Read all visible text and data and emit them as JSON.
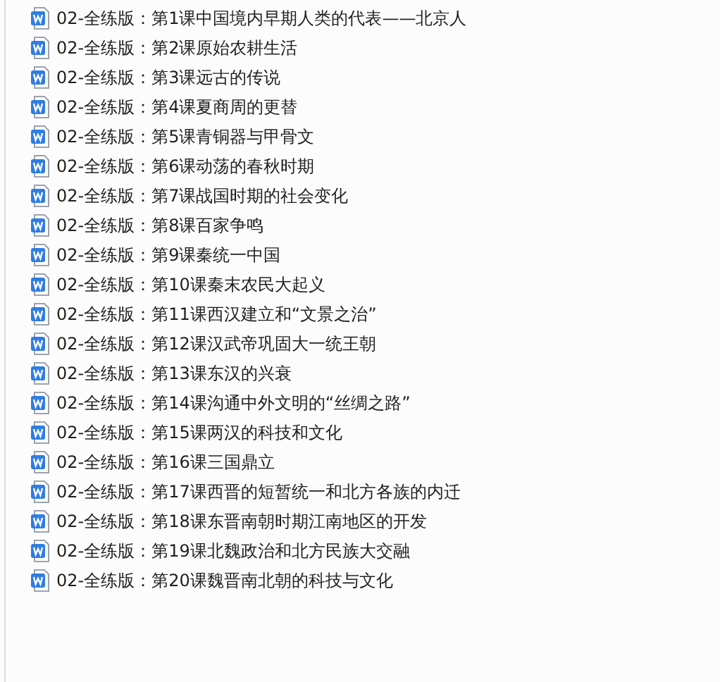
{
  "files": [
    {
      "name": "02-全练版：第1课中国境内早期人类的代表——北京人"
    },
    {
      "name": "02-全练版：第2课原始农耕生活"
    },
    {
      "name": "02-全练版：第3课远古的传说"
    },
    {
      "name": "02-全练版：第4课夏商周的更替"
    },
    {
      "name": "02-全练版：第5课青铜器与甲骨文"
    },
    {
      "name": "02-全练版：第6课动荡的春秋时期"
    },
    {
      "name": "02-全练版：第7课战国时期的社会变化"
    },
    {
      "name": "02-全练版：第8课百家争鸣"
    },
    {
      "name": "02-全练版：第9课秦统一中国"
    },
    {
      "name": "02-全练版：第10课秦末农民大起义"
    },
    {
      "name": "02-全练版：第11课西汉建立和“文景之治”"
    },
    {
      "name": "02-全练版：第12课汉武帝巩固大一统王朝"
    },
    {
      "name": "02-全练版：第13课东汉的兴衰"
    },
    {
      "name": "02-全练版：第14课沟通中外文明的“丝绸之路”"
    },
    {
      "name": "02-全练版：第15课两汉的科技和文化"
    },
    {
      "name": "02-全练版：第16课三国鼎立"
    },
    {
      "name": "02-全练版：第17课西晋的短暂统一和北方各族的内迁"
    },
    {
      "name": "02-全练版：第18课东晋南朝时期江南地区的开发"
    },
    {
      "name": "02-全练版：第19课北魏政治和北方民族大交融"
    },
    {
      "name": "02-全练版：第20课魏晋南北朝的科技与文化"
    }
  ]
}
